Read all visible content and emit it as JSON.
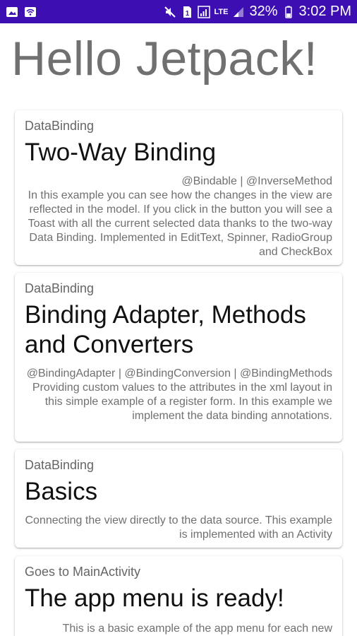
{
  "status_bar": {
    "left_icons": [
      "image-icon",
      "wifi-hotspot-icon"
    ],
    "right": {
      "icons": [
        "mute-icon",
        "sim-1-icon",
        "signal-icon",
        "lte-icon",
        "signal-weak-icon",
        "battery-icon"
      ],
      "lte_label": "LTE",
      "battery": "32%",
      "time": "3:02 PM"
    },
    "background": "#3d0fb2"
  },
  "hero_title": "Hello Jetpack!",
  "cards": [
    {
      "subtitle": "DataBinding",
      "title": "Two-Way Binding",
      "tags": "@Bindable | @InverseMethod",
      "description": "In this example you can see how the changes in the view are reflected in the model. If you click in the button you will see a Toast with all the current selected data thanks to the two-way Data Binding. Implemented in EditText, Spinner, RadioGroup and CheckBox"
    },
    {
      "subtitle": "DataBinding",
      "title": "Binding Adapter, Methods and Converters",
      "tags": "@BindingAdapter | @BindingConversion | @BindingMethods",
      "description": "Providing custom values to the attributes in the xml layout in this simple example of a register form. In this example we implement the data binding annotations."
    },
    {
      "subtitle": "DataBinding",
      "title": "Basics",
      "tags": "",
      "description": "Connecting the view directly to the data source. This example is implemented with an Activity"
    },
    {
      "subtitle": "Goes to MainActivity",
      "title": "The app menu is ready!",
      "tags": "",
      "description": "This is a basic example of the app menu for each new"
    }
  ]
}
